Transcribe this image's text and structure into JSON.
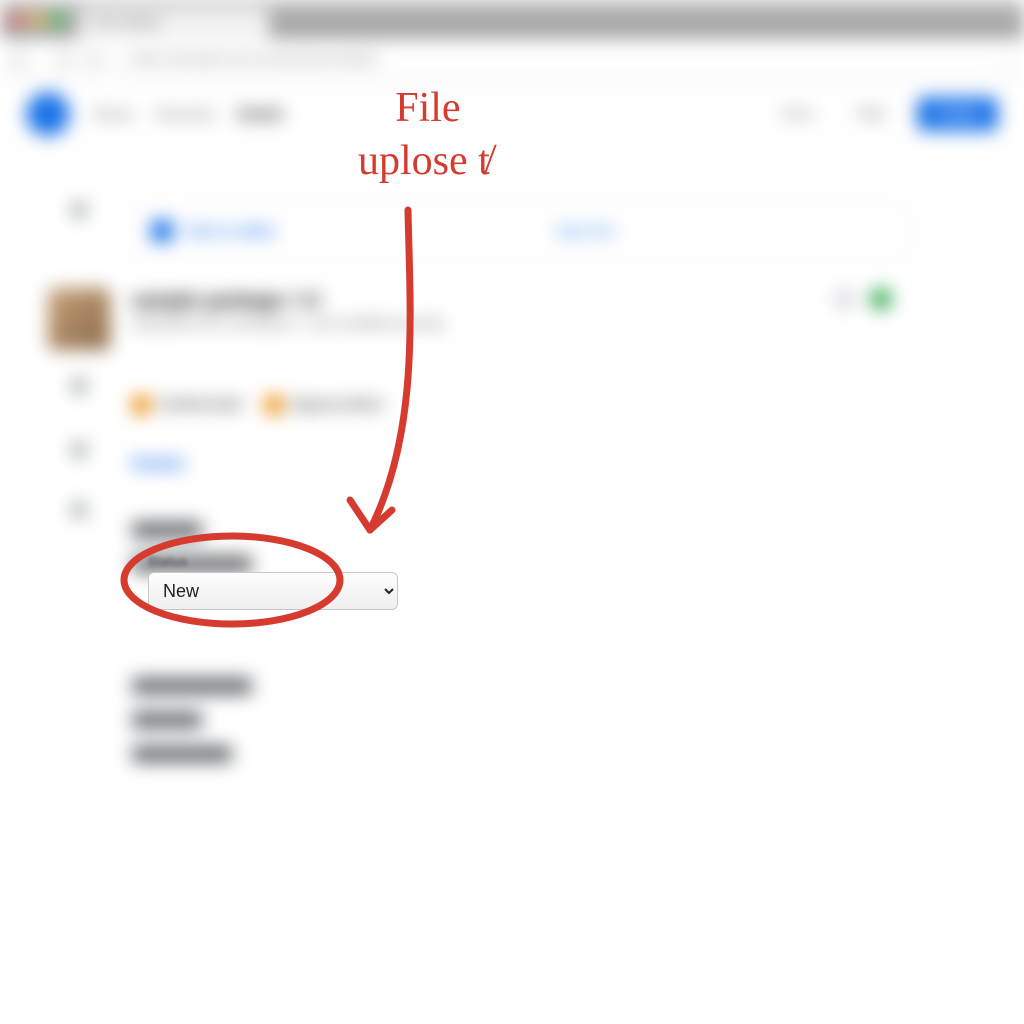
{
  "browser": {
    "tab_title": "Item details",
    "address": "https://example.com/console/item/details"
  },
  "app_header": {
    "links": [
      "Home",
      "Overview",
      "Details"
    ],
    "secondary": [
      "Docs",
      "Help"
    ],
    "cta": "Create"
  },
  "card": {
    "left_label": "View in editor",
    "right_label": "Open file"
  },
  "item": {
    "title": "sample-package-1.0",
    "subtitle": "Uploaded from workspace · Last modified recently",
    "badges": [
      "Verified build",
      "Signed artifact"
    ]
  },
  "section_heading": "Details",
  "select": {
    "label": "Status",
    "value": "New",
    "options": [
      "New"
    ]
  },
  "annotation": {
    "line1": "File",
    "line2": "uplose t̸"
  }
}
